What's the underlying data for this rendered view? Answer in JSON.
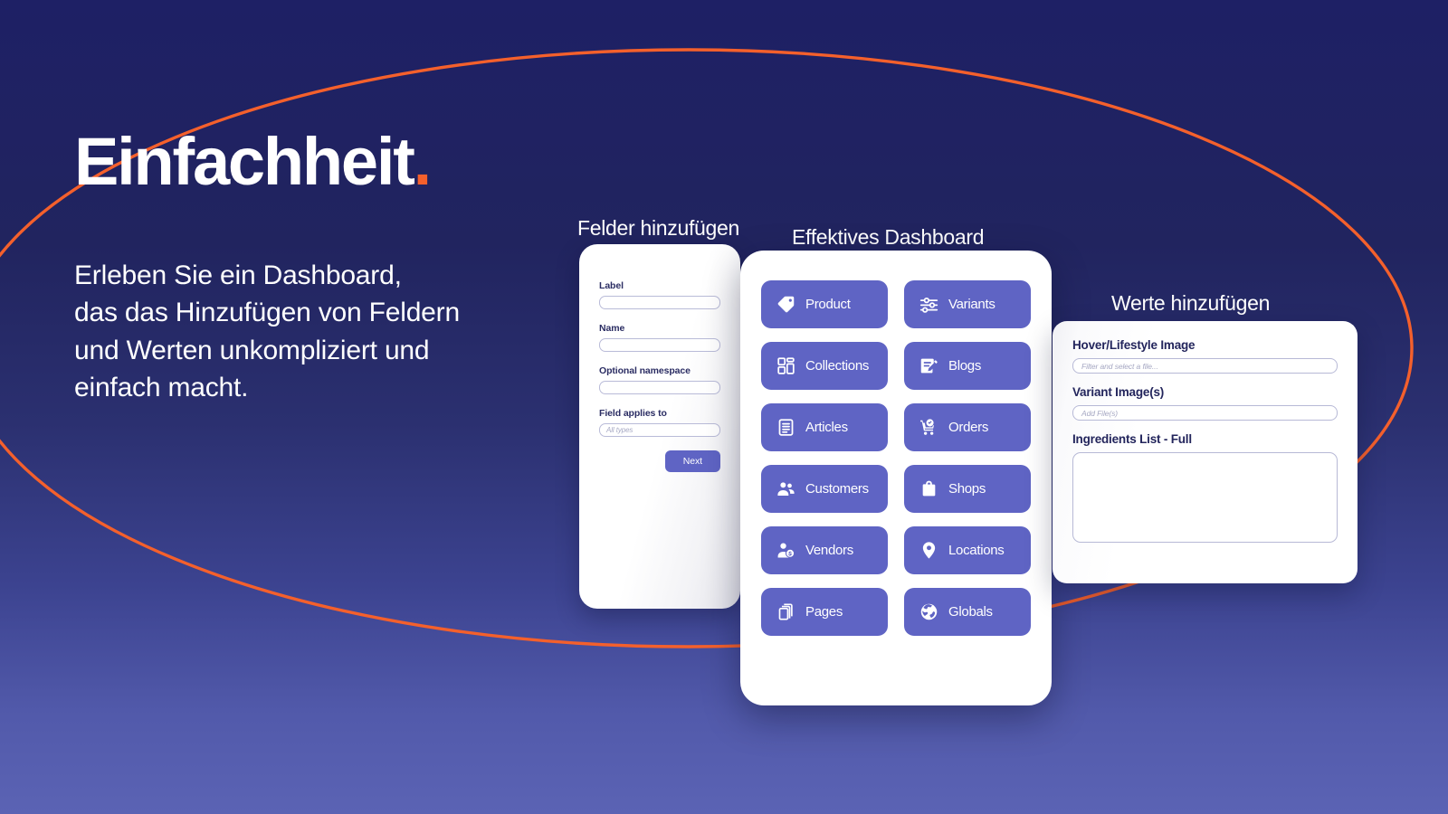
{
  "theme": {
    "bg_top": "#1e2065",
    "bg_bottom": "#5b63b4",
    "accent_orange": "#f4602c",
    "tile_purple": "#5f64c4",
    "card_white": "#ffffff",
    "label_navy": "#23255c"
  },
  "hero": {
    "title": "Einfachheit",
    "title_dot": ".",
    "subtitle": "Erleben Sie ein Dashboard,\ndas das Hinzufügen von Feldern\nund Werten unkompliziert und\neinfach macht."
  },
  "captions": {
    "fields": "Felder hinzufügen",
    "dashboard": "Effektives Dashboard",
    "values": "Werte hinzufügen"
  },
  "fields_card": {
    "fields": [
      {
        "label": "Label",
        "placeholder": "",
        "value": ""
      },
      {
        "label": "Name",
        "placeholder": "",
        "value": ""
      },
      {
        "label": "Optional namespace",
        "placeholder": "",
        "value": ""
      },
      {
        "label": "Field applies to",
        "placeholder": "All types",
        "value": ""
      }
    ],
    "next_label": "Next"
  },
  "dashboard_card": {
    "tiles": [
      {
        "label": "Product",
        "icon": "tag-icon"
      },
      {
        "label": "Variants",
        "icon": "sliders-icon"
      },
      {
        "label": "Collections",
        "icon": "grid-icon"
      },
      {
        "label": "Blogs",
        "icon": "blog-edit-icon"
      },
      {
        "label": "Articles",
        "icon": "document-lines-icon"
      },
      {
        "label": "Orders",
        "icon": "cart-check-icon"
      },
      {
        "label": "Customers",
        "icon": "people-icon"
      },
      {
        "label": "Shops",
        "icon": "shopping-bag-icon"
      },
      {
        "label": "Vendors",
        "icon": "person-badge-icon"
      },
      {
        "label": "Locations",
        "icon": "map-pin-icon"
      },
      {
        "label": "Pages",
        "icon": "pages-stack-icon"
      },
      {
        "label": "Globals",
        "icon": "globe-icon"
      }
    ]
  },
  "values_card": {
    "fields": [
      {
        "label": "Hover/Lifestyle Image",
        "placeholder": "Filter and select a file...",
        "type": "input",
        "value": ""
      },
      {
        "label": "Variant Image(s)",
        "placeholder": "Add File(s)",
        "type": "input",
        "value": ""
      },
      {
        "label": "Ingredients List - Full",
        "placeholder": "",
        "type": "textarea",
        "value": ""
      }
    ]
  }
}
